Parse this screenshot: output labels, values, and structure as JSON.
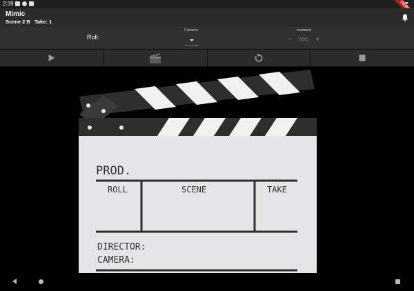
{
  "status_bar": {
    "time": "2:39",
    "debug_banner": "DEBUG"
  },
  "app_bar": {
    "title": "Mimic",
    "scene": "Scene 2 B",
    "take": "Take: 1"
  },
  "controls": {
    "roll_label": "Roll:",
    "camera_label": "Camera",
    "camera_value": "",
    "instance_label": "Instance",
    "instance_minus": "−",
    "instance_value": "001",
    "instance_plus": "+"
  },
  "toolbar": {
    "buttons": [
      {
        "name": "play-button",
        "icon": "play-icon"
      },
      {
        "name": "clapper-button",
        "icon": "clapperboard-icon"
      },
      {
        "name": "reset-button",
        "icon": "replay-icon"
      },
      {
        "name": "stop-button",
        "icon": "stop-icon"
      }
    ]
  },
  "clapperboard": {
    "prod_label": "PROD.",
    "roll_header": "ROLL",
    "scene_header": "SCENE",
    "take_header": "TAKE",
    "director_label": "DIRECTOR:",
    "camera_label": "CAMERA:"
  },
  "colors": {
    "background": "#000000",
    "appbar": "#2b2b2b",
    "board": "#e5e4e7",
    "clapper": "#2e2e2e"
  }
}
